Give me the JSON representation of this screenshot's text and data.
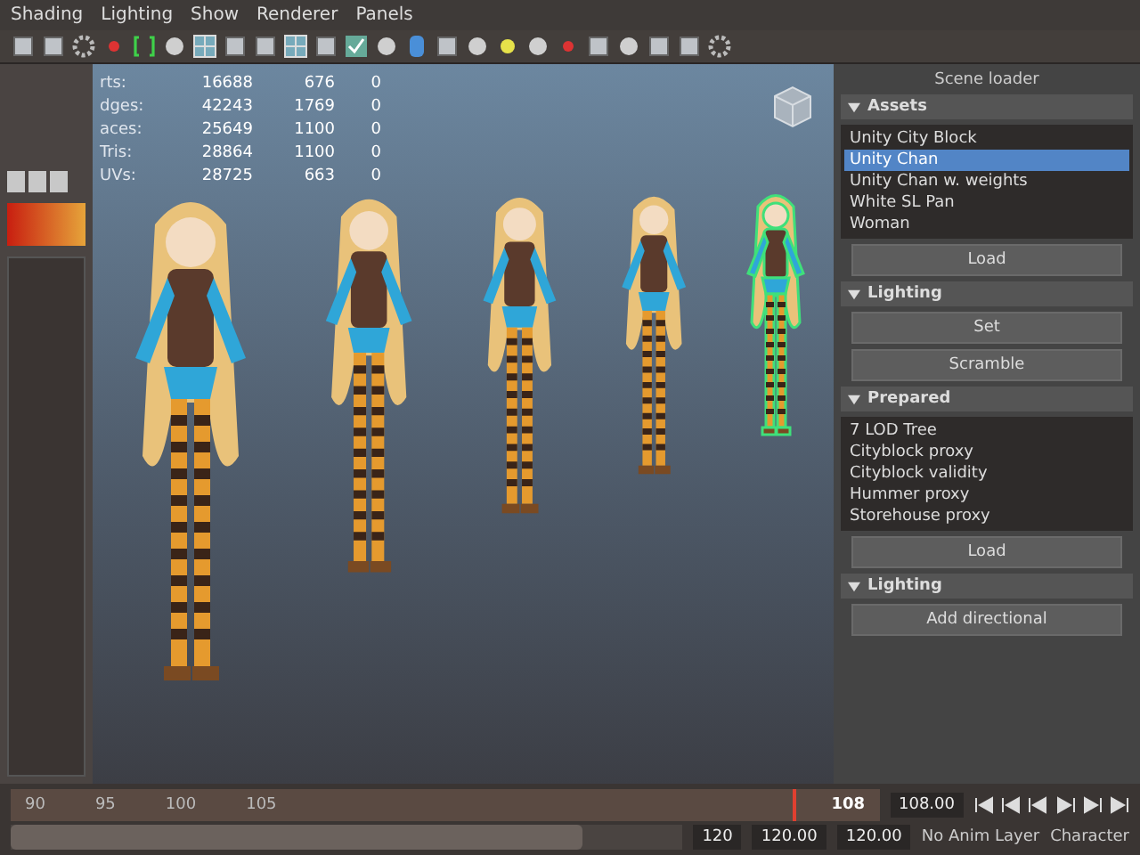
{
  "menu": [
    "Shading",
    "Lighting",
    "Show",
    "Renderer",
    "Panels"
  ],
  "hud": [
    {
      "label": "rts:",
      "values": [
        "16688",
        "676",
        "0"
      ]
    },
    {
      "label": "dges:",
      "values": [
        "42243",
        "1769",
        "0"
      ]
    },
    {
      "label": "aces:",
      "values": [
        "25649",
        "1100",
        "0"
      ]
    },
    {
      "label": "Tris:",
      "values": [
        "28864",
        "1100",
        "0"
      ]
    },
    {
      "label": "UVs:",
      "values": [
        "28725",
        "663",
        "0"
      ]
    }
  ],
  "characters": [
    {
      "selected": false
    },
    {
      "selected": false
    },
    {
      "selected": false
    },
    {
      "selected": false
    },
    {
      "selected": true
    }
  ],
  "side_panel": {
    "title": "Scene loader",
    "sections": [
      {
        "kind": "list",
        "title": "Assets",
        "items": [
          {
            "label": "Unity City Block",
            "selected": false
          },
          {
            "label": "Unity Chan",
            "selected": true
          },
          {
            "label": "Unity Chan w. weights",
            "selected": false
          },
          {
            "label": "White SL Pan",
            "selected": false
          },
          {
            "label": "Woman",
            "selected": false
          }
        ],
        "button": "Load"
      },
      {
        "kind": "buttons",
        "title": "Lighting",
        "buttons": [
          "Set",
          "Scramble"
        ]
      },
      {
        "kind": "list",
        "title": "Prepared",
        "items": [
          {
            "label": "7 LOD Tree",
            "selected": false
          },
          {
            "label": "Cityblock proxy",
            "selected": false
          },
          {
            "label": "Cityblock validity",
            "selected": false
          },
          {
            "label": "Hummer proxy",
            "selected": false
          },
          {
            "label": "Storehouse proxy",
            "selected": false
          }
        ],
        "button": "Load"
      },
      {
        "kind": "buttons",
        "title": "Lighting",
        "buttons": [
          "Add directional"
        ]
      }
    ]
  },
  "timeline": {
    "playhead": {
      "level": 0.9
    },
    "range": {
      "level": 0.85
    },
    "ticks": [
      "90",
      "95",
      "100",
      "105"
    ],
    "current": "108",
    "current_field": "108.00",
    "range_fields": [
      "120",
      "120.00",
      "120.00"
    ],
    "anim_layer": "No Anim Layer",
    "character": "Character"
  }
}
